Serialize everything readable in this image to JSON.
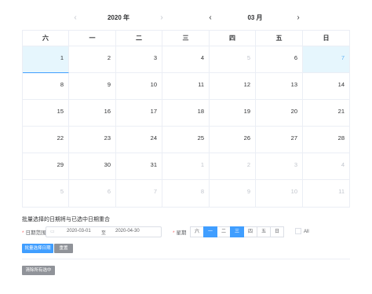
{
  "left_nav": {
    "prev_icon": "‹",
    "label": "2020 年",
    "next_icon": "›"
  },
  "right_nav": {
    "prev_icon": "‹",
    "label": "03 月",
    "next_icon": "›"
  },
  "weekdays": [
    "六",
    "一",
    "二",
    "三",
    "四",
    "五",
    "日"
  ],
  "weeks": [
    [
      {
        "d": "1",
        "t": "hl"
      },
      {
        "d": "2"
      },
      {
        "d": "3"
      },
      {
        "d": "4"
      },
      {
        "d": "5",
        "t": "other"
      },
      {
        "d": "6"
      },
      {
        "d": "7",
        "t": "hlblue"
      }
    ],
    [
      {
        "d": "8"
      },
      {
        "d": "9"
      },
      {
        "d": "10"
      },
      {
        "d": "11"
      },
      {
        "d": "12"
      },
      {
        "d": "13"
      },
      {
        "d": "14"
      }
    ],
    [
      {
        "d": "15"
      },
      {
        "d": "16"
      },
      {
        "d": "17"
      },
      {
        "d": "18"
      },
      {
        "d": "19"
      },
      {
        "d": "20"
      },
      {
        "d": "21"
      }
    ],
    [
      {
        "d": "22"
      },
      {
        "d": "23"
      },
      {
        "d": "24"
      },
      {
        "d": "25"
      },
      {
        "d": "26"
      },
      {
        "d": "27"
      },
      {
        "d": "28"
      }
    ],
    [
      {
        "d": "29"
      },
      {
        "d": "30"
      },
      {
        "d": "31"
      },
      {
        "d": "1",
        "t": "other"
      },
      {
        "d": "2",
        "t": "other"
      },
      {
        "d": "3",
        "t": "other"
      },
      {
        "d": "4",
        "t": "other"
      }
    ],
    [
      {
        "d": "5",
        "t": "other"
      },
      {
        "d": "6",
        "t": "other"
      },
      {
        "d": "7",
        "t": "other"
      },
      {
        "d": "8",
        "t": "other"
      },
      {
        "d": "9",
        "t": "other"
      },
      {
        "d": "10",
        "t": "other"
      },
      {
        "d": "11",
        "t": "other"
      }
    ]
  ],
  "form": {
    "title": "批量选择的日期将与已选中日期重合",
    "date_range_label": "日期范围",
    "start_date": "2020-03-01",
    "separator": "至",
    "end_date": "2020-04-30",
    "week_label": "星期",
    "week_days": [
      "六",
      "一",
      "二",
      "三",
      "四",
      "五",
      "日"
    ],
    "week_selected": [
      "一",
      "三"
    ],
    "all_label": "All",
    "batch_button": "批量选择日期",
    "reset_button": "重置",
    "clear_button": "清除所有选中"
  },
  "colors": {
    "accent": "#409eff",
    "highlight": "#e6f6fd",
    "muted": "#c0c4cc"
  }
}
